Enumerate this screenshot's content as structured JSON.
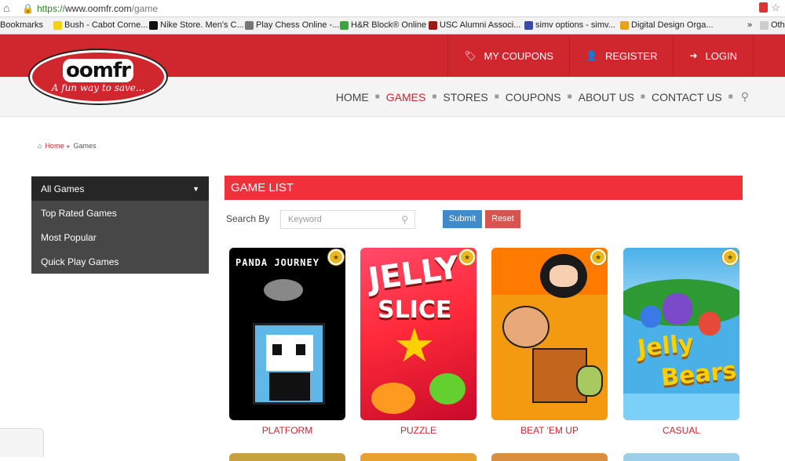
{
  "browser": {
    "url_protocol": "https://",
    "url_host": "www.oomfr.com",
    "url_path": "/game",
    "bookmarks": [
      {
        "label": "Bookmarks",
        "color": "#f2f2f2"
      },
      {
        "label": "Bush - Cabot Corne...",
        "color": "#f1d40a"
      },
      {
        "label": "Nike Store. Men's C...",
        "color": "#111111"
      },
      {
        "label": "Play Chess Online -...",
        "color": "#777777"
      },
      {
        "label": "H&R Block® Online",
        "color": "#3aa53a"
      },
      {
        "label": "USC Alumni Associ...",
        "color": "#9a1a1a"
      },
      {
        "label": "simv options - simv...",
        "color": "#3a4aa8"
      },
      {
        "label": "Digital Design Orga...",
        "color": "#e8a21a"
      },
      {
        "label": "Othe",
        "color": "#cccccc"
      }
    ]
  },
  "site": {
    "logo_text": "oomfr",
    "logo_tagline": "A fun way to save...",
    "accent_color": "#d0262d",
    "top_nav": [
      {
        "label": "MY COUPONS",
        "icon": "tag-icon",
        "glyph": "🏷"
      },
      {
        "label": "REGISTER",
        "icon": "user-plus-icon",
        "glyph": "👤"
      },
      {
        "label": "LOGIN",
        "icon": "sign-in-icon",
        "glyph": "➜"
      }
    ],
    "main_nav": [
      "HOME",
      "GAMES",
      "STORES",
      "COUPONS",
      "ABOUT US",
      "CONTACT US"
    ],
    "main_nav_active": "GAMES"
  },
  "breadcrumb": {
    "home": "Home",
    "current": "Games"
  },
  "sidebar": {
    "items": [
      "All Games",
      "Top Rated Games",
      "Most Popular",
      "Quick Play Games"
    ],
    "active": "All Games"
  },
  "content": {
    "title": "GAME LIST",
    "search_label": "Search By",
    "keyword_placeholder": "Keyword",
    "submit_label": "Submit",
    "reset_label": "Reset",
    "games": [
      {
        "category": "PLATFORM",
        "thumb_title": "PANDA JOURNEY"
      },
      {
        "category": "PUZZLE",
        "thumb_title_1": "JELLY",
        "thumb_title_2": "SLICE"
      },
      {
        "category": "BEAT 'EM UP"
      },
      {
        "category": "CASUAL",
        "thumb_title_1": "Jelly",
        "thumb_title_2": "Bears"
      }
    ]
  }
}
